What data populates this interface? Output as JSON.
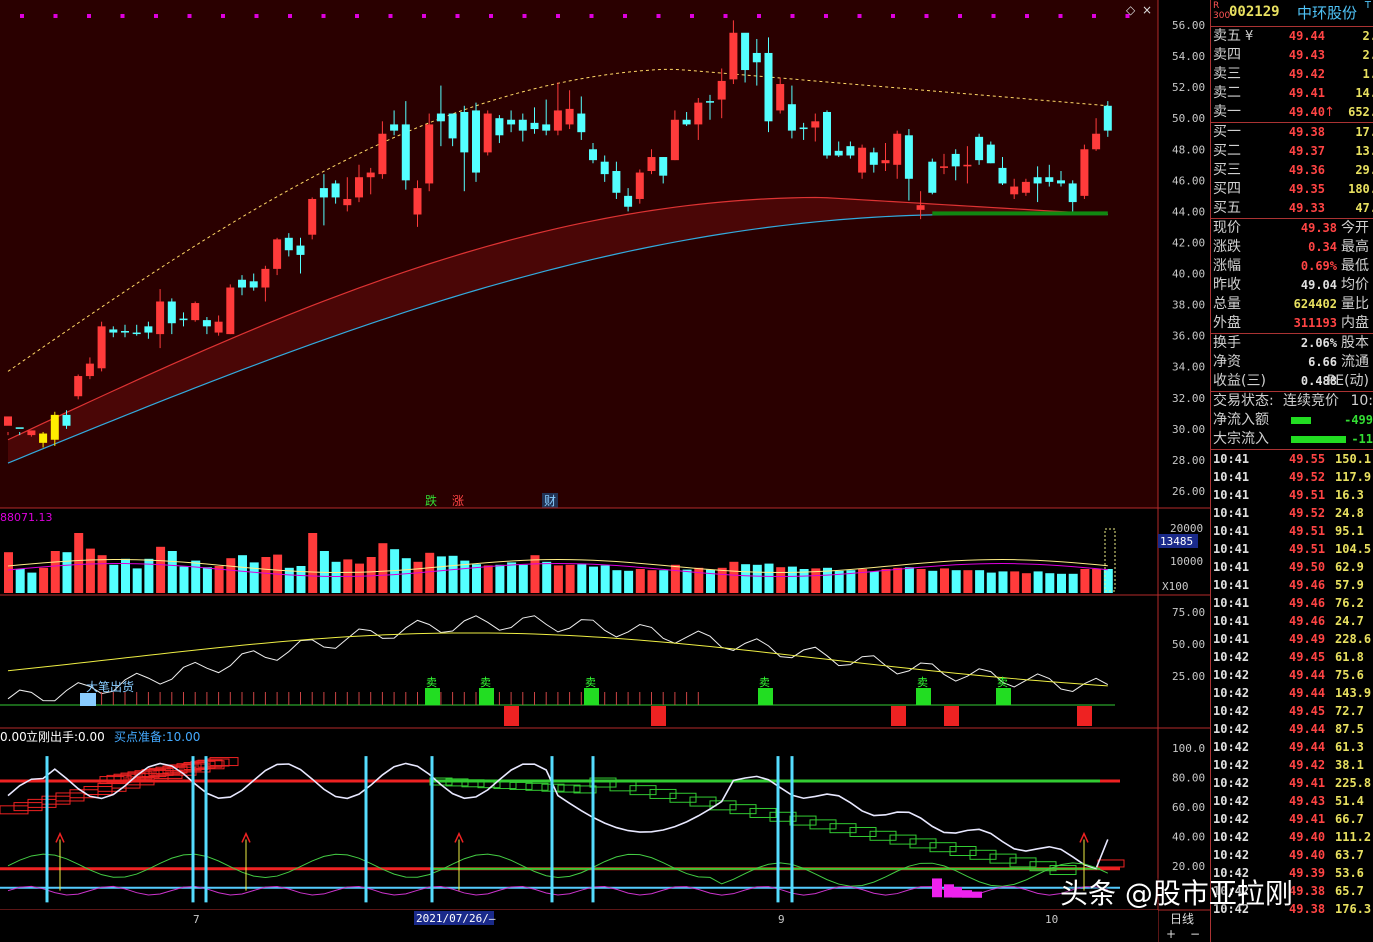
{
  "stock": {
    "market_tag": "R\n300",
    "code": "002129",
    "name": "中环股份",
    "t_tag": "T"
  },
  "colors": {
    "up": "#ff3b3b",
    "down": "#54ffff",
    "bg": "#000000",
    "frame": "#b52a2a",
    "grid_text": "#c8c8c8"
  },
  "price_axis": {
    "labels": [
      "56.00",
      "54.00",
      "52.00",
      "50.00",
      "48.00",
      "46.00",
      "44.00",
      "42.00",
      "40.00",
      "38.00",
      "36.00",
      "34.00",
      "32.00",
      "30.00",
      "28.00",
      "26.00"
    ]
  },
  "price_markers": {
    "die": "跌",
    "zhang": "涨",
    "cai": "财"
  },
  "volume_panel": {
    "left_value": "88071.13",
    "axis": [
      "20000",
      "10000"
    ],
    "current": "13485",
    "unit": "X100"
  },
  "ind1_panel": {
    "axis": [
      "75.00",
      "50.00",
      "25.00"
    ],
    "label_dachu": "大笔出货",
    "sell_label": "卖"
  },
  "ind2_panel": {
    "legend_a": "0.00",
    "legend_b_name": "立刚出手:",
    "legend_b_val": "0.00",
    "legend_c_name": "买点准备:",
    "legend_c_val": "10.00",
    "axis": [
      "100.0",
      "80.00",
      "60.00",
      "40.00",
      "20.00"
    ]
  },
  "date_axis": {
    "m7": "7",
    "sel_date": "2021/07/26/—",
    "m9": "9",
    "m10": "10",
    "period": "日线"
  },
  "ask": [
    {
      "label": "卖五",
      "price": "49.44",
      "vol": "2."
    },
    {
      "label": "卖四",
      "price": "49.43",
      "vol": "2."
    },
    {
      "label": "卖三",
      "price": "49.42",
      "vol": "1."
    },
    {
      "label": "卖二",
      "price": "49.41",
      "vol": "14."
    },
    {
      "label": "卖一",
      "price": "49.40",
      "vol": "652."
    }
  ],
  "ask_currency": "¥",
  "bid": [
    {
      "label": "买一",
      "price": "49.38",
      "vol": "17."
    },
    {
      "label": "买二",
      "price": "49.37",
      "vol": "13."
    },
    {
      "label": "买三",
      "price": "49.36",
      "vol": "29."
    },
    {
      "label": "买四",
      "price": "49.35",
      "vol": "180."
    },
    {
      "label": "买五",
      "price": "49.33",
      "vol": "47."
    }
  ],
  "stats": [
    {
      "label": "现价",
      "value": "49.38",
      "label2": "今开",
      "cls": "up"
    },
    {
      "label": "涨跌",
      "value": "0.34",
      "label2": "最高",
      "cls": "up"
    },
    {
      "label": "涨幅",
      "value": "0.69%",
      "label2": "最低",
      "cls": "up"
    },
    {
      "label": "昨收",
      "value": "49.04",
      "label2": "均价",
      "cls": "wh"
    },
    {
      "label": "总量",
      "value": "624402",
      "label2": "量比",
      "cls": "ye"
    },
    {
      "label": "外盘",
      "value": "311193",
      "label2": "内盘",
      "cls": "up"
    }
  ],
  "stats2": [
    {
      "label": "换手",
      "value": "2.06%",
      "label2": "股本",
      "cls": "wh"
    },
    {
      "label": "净资",
      "value": "6.66",
      "label2": "流通",
      "cls": "wh"
    },
    {
      "label": "收益(三)",
      "value": "0.488",
      "label2": "PE(动)",
      "cls": "wh"
    }
  ],
  "trade_status": {
    "label": "交易状态:",
    "value": "连续竞价",
    "time": "10:"
  },
  "flows": [
    {
      "label": "净流入额",
      "value": "-499",
      "bar": 0.2
    },
    {
      "label": "大宗流入",
      "value": "-11",
      "bar": 0.55
    }
  ],
  "ticks": [
    {
      "t": "10:41",
      "p": "49.55",
      "v": "150.1",
      "c": "up"
    },
    {
      "t": "10:41",
      "p": "49.52",
      "v": "117.9",
      "c": "up"
    },
    {
      "t": "10:41",
      "p": "49.51",
      "v": "16.3",
      "c": "up"
    },
    {
      "t": "10:41",
      "p": "49.52",
      "v": "24.8",
      "c": "up"
    },
    {
      "t": "10:41",
      "p": "49.51",
      "v": "95.1",
      "c": "up"
    },
    {
      "t": "10:41",
      "p": "49.51",
      "v": "104.5",
      "c": "up"
    },
    {
      "t": "10:41",
      "p": "49.50",
      "v": "62.9",
      "c": "up"
    },
    {
      "t": "10:41",
      "p": "49.46",
      "v": "57.9",
      "c": "up"
    },
    {
      "t": "10:41",
      "p": "49.46",
      "v": "76.2",
      "c": "up"
    },
    {
      "t": "10:41",
      "p": "49.46",
      "v": "24.7",
      "c": "up"
    },
    {
      "t": "10:41",
      "p": "49.49",
      "v": "228.6",
      "c": "up"
    },
    {
      "t": "10:42",
      "p": "49.45",
      "v": "61.8",
      "c": "up"
    },
    {
      "t": "10:42",
      "p": "49.44",
      "v": "75.6",
      "c": "up"
    },
    {
      "t": "10:42",
      "p": "49.44",
      "v": "143.9",
      "c": "up"
    },
    {
      "t": "10:42",
      "p": "49.45",
      "v": "72.7",
      "c": "up"
    },
    {
      "t": "10:42",
      "p": "49.44",
      "v": "87.5",
      "c": "up"
    },
    {
      "t": "10:42",
      "p": "49.44",
      "v": "61.3",
      "c": "up"
    },
    {
      "t": "10:42",
      "p": "49.42",
      "v": "38.1",
      "c": "up"
    },
    {
      "t": "10:42",
      "p": "49.41",
      "v": "225.8",
      "c": "up"
    },
    {
      "t": "10:42",
      "p": "49.43",
      "v": "51.4",
      "c": "up"
    },
    {
      "t": "10:42",
      "p": "49.41",
      "v": "66.7",
      "c": "up"
    },
    {
      "t": "10:42",
      "p": "49.40",
      "v": "111.2",
      "c": "up"
    },
    {
      "t": "10:42",
      "p": "49.40",
      "v": "63.7",
      "c": "up"
    },
    {
      "t": "10:42",
      "p": "49.39",
      "v": "53.6",
      "c": "up"
    },
    {
      "t": "10:42",
      "p": "49.38",
      "v": "65.7",
      "c": "up"
    },
    {
      "t": "10:42",
      "p": "49.38",
      "v": "176.3",
      "c": "up"
    }
  ],
  "watermark": "头条 @股市亚拉刚",
  "candles": [
    [
      30.2,
      30.8,
      29.8,
      29.6,
      "u"
    ],
    [
      30.0,
      30.1,
      29.6,
      29.8,
      "d"
    ],
    [
      29.6,
      29.9,
      29.5,
      29.8,
      "u"
    ],
    [
      29.1,
      29.7,
      28.8,
      29.8,
      "y"
    ],
    [
      29.3,
      30.9,
      28.9,
      31.1,
      "y"
    ],
    [
      30.9,
      30.2,
      30.0,
      31.2,
      "d"
    ],
    [
      32.1,
      33.4,
      31.9,
      33.5,
      "u"
    ],
    [
      33.4,
      34.2,
      33.2,
      34.6,
      "u"
    ],
    [
      33.9,
      36.6,
      33.7,
      36.9,
      "u"
    ],
    [
      36.4,
      36.2,
      35.9,
      36.6,
      "d"
    ],
    [
      36.3,
      36.2,
      35.9,
      36.7,
      "d"
    ],
    [
      36.2,
      36.2,
      36.0,
      36.7,
      "d"
    ],
    [
      36.2,
      36.6,
      35.8,
      36.9,
      "d"
    ],
    [
      36.1,
      38.2,
      35.2,
      39.0,
      "u"
    ],
    [
      38.2,
      36.8,
      36.1,
      38.4,
      "d"
    ],
    [
      37.0,
      37.1,
      36.6,
      37.5,
      "d"
    ],
    [
      37.0,
      38.1,
      36.9,
      38.2,
      "u"
    ],
    [
      37.0,
      36.6,
      36.1,
      37.2,
      "d"
    ],
    [
      36.2,
      36.9,
      36.0,
      37.3,
      "u"
    ],
    [
      36.1,
      39.1,
      36.1,
      39.3,
      "u"
    ],
    [
      39.1,
      39.6,
      38.6,
      39.9,
      "d"
    ],
    [
      39.5,
      39.1,
      38.9,
      40.0,
      "d"
    ],
    [
      39.1,
      40.3,
      38.2,
      40.5,
      "u"
    ],
    [
      40.3,
      42.2,
      39.9,
      42.3,
      "u"
    ],
    [
      42.3,
      41.5,
      41.1,
      42.6,
      "d"
    ],
    [
      41.2,
      41.8,
      40.0,
      42.3,
      "d"
    ],
    [
      42.5,
      44.8,
      42.2,
      44.9,
      "u"
    ],
    [
      44.9,
      45.5,
      43.1,
      46.4,
      "d"
    ],
    [
      45.8,
      44.9,
      44.5,
      46.0,
      "d"
    ],
    [
      44.4,
      44.8,
      44.0,
      46.2,
      "u"
    ],
    [
      44.9,
      46.2,
      44.6,
      47.0,
      "u"
    ],
    [
      46.2,
      46.5,
      45.1,
      46.8,
      "u"
    ],
    [
      46.4,
      49.0,
      46.1,
      49.8,
      "u"
    ],
    [
      49.2,
      49.6,
      48.9,
      50.5,
      "d"
    ],
    [
      49.6,
      46.0,
      45.4,
      51.1,
      "d"
    ],
    [
      45.5,
      43.8,
      43.0,
      46.0,
      "u"
    ],
    [
      45.8,
      49.6,
      45.3,
      50.3,
      "u"
    ],
    [
      49.8,
      50.3,
      48.2,
      52.1,
      "d"
    ],
    [
      50.3,
      48.7,
      48.2,
      50.3,
      "d"
    ],
    [
      47.8,
      50.4,
      45.3,
      50.8,
      "d"
    ],
    [
      50.5,
      46.5,
      45.9,
      51.0,
      "d"
    ],
    [
      47.8,
      50.3,
      47.6,
      50.5,
      "u"
    ],
    [
      50.0,
      48.9,
      48.4,
      50.2,
      "d"
    ],
    [
      49.6,
      49.9,
      49.1,
      50.5,
      "d"
    ],
    [
      49.9,
      49.2,
      48.5,
      50.3,
      "d"
    ],
    [
      49.3,
      49.7,
      49.0,
      50.7,
      "d"
    ],
    [
      49.6,
      49.2,
      48.9,
      51.2,
      "d"
    ],
    [
      49.2,
      50.5,
      48.9,
      52.3,
      "u"
    ],
    [
      50.6,
      49.6,
      49.3,
      51.8,
      "u"
    ],
    [
      50.3,
      49.1,
      48.6,
      51.4,
      "d"
    ],
    [
      48.0,
      47.3,
      47.1,
      48.4,
      "d"
    ],
    [
      47.2,
      46.4,
      45.9,
      47.6,
      "d"
    ],
    [
      46.6,
      45.2,
      44.8,
      47.2,
      "d"
    ],
    [
      45.0,
      44.3,
      44.0,
      45.5,
      "d"
    ],
    [
      44.8,
      46.5,
      44.5,
      46.7,
      "u"
    ],
    [
      46.6,
      47.5,
      46.4,
      48.0,
      "u"
    ],
    [
      47.5,
      46.3,
      45.8,
      47.5,
      "d"
    ],
    [
      47.3,
      49.9,
      47.3,
      50.5,
      "u"
    ],
    [
      49.9,
      49.6,
      49.5,
      50.4,
      "d"
    ],
    [
      49.6,
      51.0,
      48.6,
      51.3,
      "u"
    ],
    [
      51.0,
      51.1,
      49.9,
      51.5,
      "d"
    ],
    [
      51.2,
      52.4,
      50.0,
      53.2,
      "u"
    ],
    [
      52.5,
      55.5,
      52.2,
      56.3,
      "u"
    ],
    [
      55.5,
      53.1,
      52.3,
      54.9,
      "d"
    ],
    [
      53.6,
      54.2,
      52.1,
      55.1,
      "d"
    ],
    [
      54.2,
      49.8,
      49.1,
      55.2,
      "d"
    ],
    [
      50.5,
      52.2,
      50.3,
      52.6,
      "u"
    ],
    [
      50.9,
      49.2,
      48.7,
      52.1,
      "d"
    ],
    [
      49.3,
      49.4,
      48.6,
      49.7,
      "d"
    ],
    [
      49.4,
      49.8,
      48.5,
      50.3,
      "u"
    ],
    [
      50.4,
      47.6,
      47.4,
      50.5,
      "d"
    ],
    [
      47.6,
      47.9,
      47.5,
      48.5,
      "d"
    ],
    [
      47.6,
      48.2,
      47.4,
      48.5,
      "d"
    ],
    [
      48.1,
      46.5,
      46.1,
      48.3,
      "u"
    ],
    [
      47.0,
      47.8,
      46.5,
      48.1,
      "d"
    ],
    [
      47.1,
      47.3,
      46.6,
      48.4,
      "u"
    ],
    [
      47.0,
      49.0,
      46.1,
      49.2,
      "u"
    ],
    [
      48.9,
      46.1,
      44.7,
      49.3,
      "d"
    ],
    [
      44.4,
      44.1,
      43.5,
      45.3,
      "u"
    ],
    [
      45.2,
      47.2,
      45.1,
      47.4,
      "d"
    ],
    [
      46.9,
      46.8,
      46.4,
      47.7,
      "u"
    ],
    [
      46.9,
      47.7,
      46.0,
      48.0,
      "d"
    ],
    [
      47.0,
      46.9,
      45.8,
      48.2,
      "u"
    ],
    [
      47.3,
      48.8,
      47.0,
      49.0,
      "d"
    ],
    [
      48.3,
      47.1,
      47.1,
      48.5,
      "d"
    ],
    [
      46.8,
      45.8,
      45.7,
      47.5,
      "d"
    ],
    [
      45.6,
      45.1,
      44.8,
      46.1,
      "u"
    ],
    [
      45.2,
      45.9,
      45.0,
      46.1,
      "u"
    ],
    [
      45.8,
      46.2,
      44.6,
      46.9,
      "d"
    ],
    [
      46.2,
      45.9,
      45.6,
      47.0,
      "d"
    ],
    [
      46.0,
      45.8,
      45.6,
      46.6,
      "d"
    ],
    [
      45.8,
      44.6,
      44.0,
      46.0,
      "d"
    ],
    [
      45.0,
      48.0,
      44.8,
      48.3,
      "u"
    ],
    [
      48.0,
      49.0,
      47.9,
      50.0,
      "u"
    ],
    [
      49.2,
      50.8,
      48.8,
      51.1,
      "d"
    ]
  ],
  "volumes": [
    [
      0.68,
      "u"
    ],
    [
      0.4,
      "d"
    ],
    [
      0.34,
      "d"
    ],
    [
      0.42,
      "u"
    ],
    [
      0.7,
      "u"
    ],
    [
      0.68,
      "d"
    ],
    [
      1.0,
      "u"
    ],
    [
      0.74,
      "u"
    ],
    [
      0.63,
      "u"
    ],
    [
      0.47,
      "d"
    ],
    [
      0.57,
      "d"
    ],
    [
      0.41,
      "d"
    ],
    [
      0.57,
      "d"
    ],
    [
      0.77,
      "u"
    ],
    [
      0.7,
      "d"
    ],
    [
      0.44,
      "d"
    ],
    [
      0.54,
      "d"
    ],
    [
      0.43,
      "d"
    ],
    [
      0.45,
      "u"
    ],
    [
      0.58,
      "u"
    ],
    [
      0.63,
      "d"
    ],
    [
      0.51,
      "d"
    ],
    [
      0.6,
      "u"
    ],
    [
      0.64,
      "u"
    ],
    [
      0.42,
      "d"
    ],
    [
      0.45,
      "d"
    ],
    [
      1.0,
      "u"
    ],
    [
      0.7,
      "d"
    ],
    [
      0.52,
      "d"
    ],
    [
      0.56,
      "u"
    ],
    [
      0.49,
      "u"
    ],
    [
      0.6,
      "u"
    ],
    [
      0.83,
      "u"
    ],
    [
      0.73,
      "d"
    ],
    [
      0.58,
      "d"
    ],
    [
      0.52,
      "u"
    ],
    [
      0.67,
      "u"
    ],
    [
      0.61,
      "d"
    ],
    [
      0.62,
      "d"
    ],
    [
      0.54,
      "d"
    ],
    [
      0.48,
      "d"
    ],
    [
      0.46,
      "u"
    ],
    [
      0.47,
      "d"
    ],
    [
      0.51,
      "d"
    ],
    [
      0.47,
      "d"
    ],
    [
      0.63,
      "u"
    ],
    [
      0.52,
      "d"
    ],
    [
      0.46,
      "u"
    ],
    [
      0.47,
      "u"
    ],
    [
      0.48,
      "d"
    ],
    [
      0.44,
      "d"
    ],
    [
      0.46,
      "d"
    ],
    [
      0.38,
      "d"
    ],
    [
      0.37,
      "d"
    ],
    [
      0.4,
      "u"
    ],
    [
      0.38,
      "u"
    ],
    [
      0.38,
      "d"
    ],
    [
      0.47,
      "u"
    ],
    [
      0.39,
      "d"
    ],
    [
      0.42,
      "u"
    ],
    [
      0.39,
      "d"
    ],
    [
      0.42,
      "u"
    ],
    [
      0.52,
      "u"
    ],
    [
      0.48,
      "d"
    ],
    [
      0.47,
      "d"
    ],
    [
      0.49,
      "d"
    ],
    [
      0.43,
      "u"
    ],
    [
      0.44,
      "d"
    ],
    [
      0.4,
      "d"
    ],
    [
      0.41,
      "u"
    ],
    [
      0.42,
      "d"
    ],
    [
      0.37,
      "d"
    ],
    [
      0.38,
      "d"
    ],
    [
      0.4,
      "u"
    ],
    [
      0.36,
      "d"
    ],
    [
      0.4,
      "u"
    ],
    [
      0.42,
      "u"
    ],
    [
      0.43,
      "d"
    ],
    [
      0.4,
      "u"
    ],
    [
      0.37,
      "d"
    ],
    [
      0.41,
      "u"
    ],
    [
      0.38,
      "d"
    ],
    [
      0.38,
      "u"
    ],
    [
      0.38,
      "d"
    ],
    [
      0.34,
      "d"
    ],
    [
      0.36,
      "d"
    ],
    [
      0.36,
      "u"
    ],
    [
      0.33,
      "u"
    ],
    [
      0.36,
      "d"
    ],
    [
      0.33,
      "d"
    ],
    [
      0.32,
      "d"
    ],
    [
      0.32,
      "d"
    ],
    [
      0.4,
      "u"
    ],
    [
      0.4,
      "u"
    ],
    [
      0.4,
      "d"
    ]
  ]
}
